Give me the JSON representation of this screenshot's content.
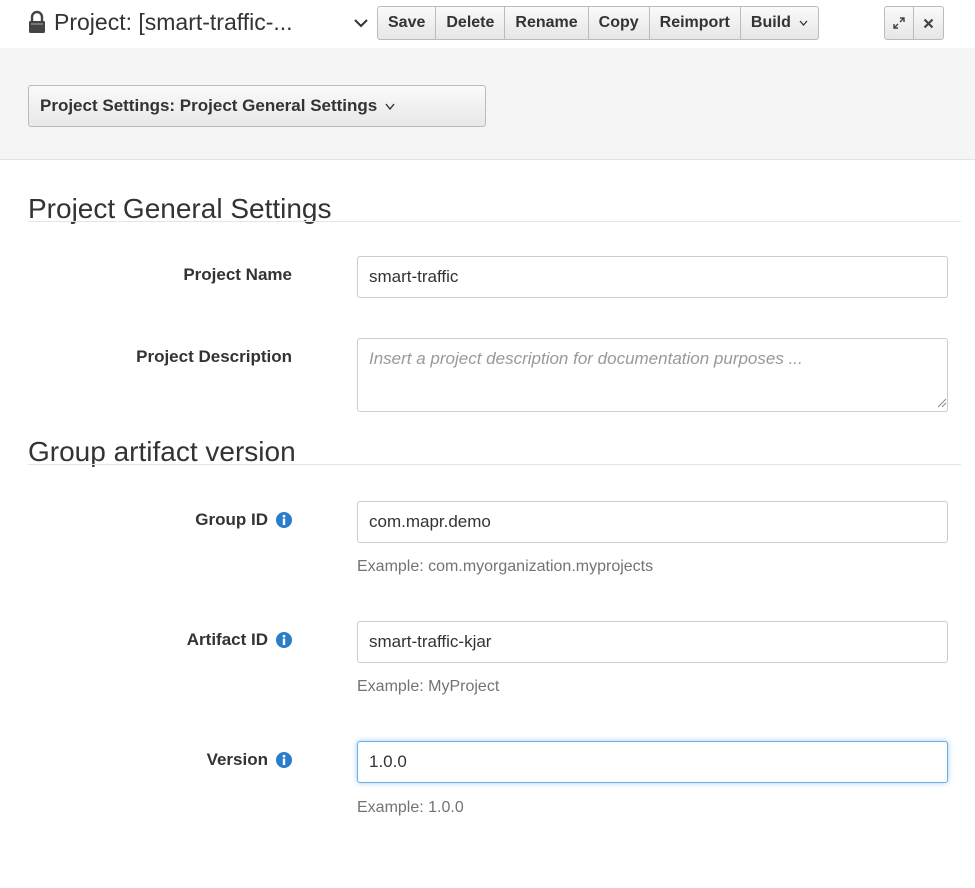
{
  "header": {
    "title": "Project: [smart-traffic-...",
    "lock_icon": "lock-icon",
    "buttons": {
      "save": "Save",
      "delete": "Delete",
      "rename": "Rename",
      "copy": "Copy",
      "reimport": "Reimport",
      "build": "Build"
    },
    "window_icons": [
      "expand-icon",
      "close-icon"
    ]
  },
  "settings_selector": {
    "label": "Project Settings: Project General Settings"
  },
  "general": {
    "heading": "Project General Settings",
    "project_name_label": "Project Name",
    "project_name_value": "smart-traffic",
    "project_description_label": "Project Description",
    "project_description_placeholder": "Insert a project description for documentation purposes ..."
  },
  "gav": {
    "heading": "Group artifact version",
    "group_id_label": "Group ID",
    "group_id_value": "com.mapr.demo",
    "group_id_help": "Example: com.myorganization.myprojects",
    "artifact_id_label": "Artifact ID",
    "artifact_id_value": "smart-traffic-kjar",
    "artifact_id_help": "Example: MyProject",
    "version_label": "Version",
    "version_value": "1.0.0",
    "version_help": "Example: 1.0.0"
  },
  "colors": {
    "info_icon": "#2a7dc9",
    "focus_border": "#66afe9",
    "band_background": "#f5f5f5"
  }
}
